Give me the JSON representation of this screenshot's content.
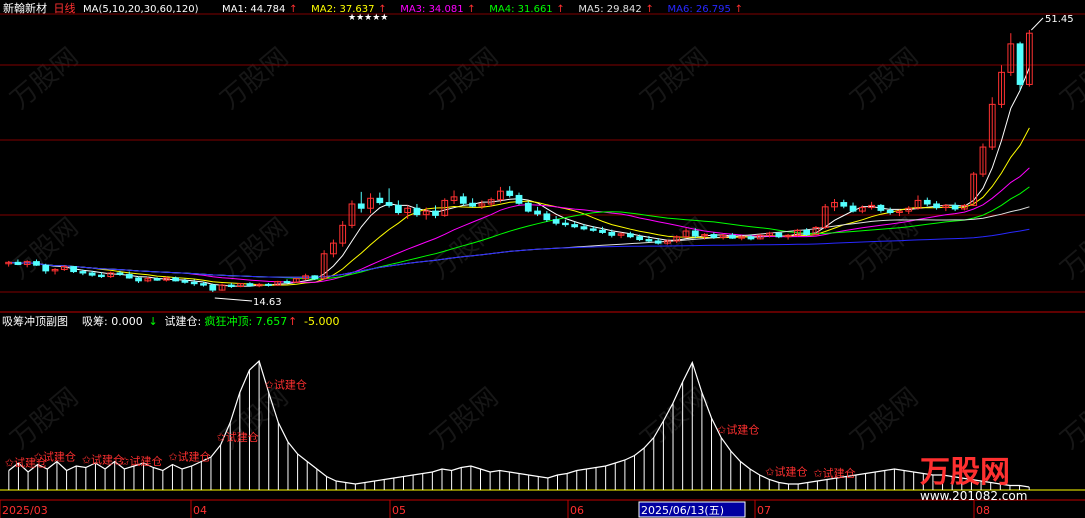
{
  "header": {
    "stock_name": "新翰新材",
    "period": "日线",
    "ma_spec": "MA(5,10,20,30,60,120)",
    "ma_items": [
      {
        "label": "MA1: 44.784",
        "arrow": "↑",
        "color": "#ffffff"
      },
      {
        "label": "MA2: 37.637",
        "arrow": "↑",
        "color": "#ffff00"
      },
      {
        "label": "MA3: 34.081",
        "arrow": "↑",
        "color": "#ff00ff"
      },
      {
        "label": "MA4: 31.661",
        "arrow": "↑",
        "color": "#00ff00"
      },
      {
        "label": "MA5: 29.842",
        "arrow": "↑",
        "color": "#e0e0e0"
      },
      {
        "label": "MA6: 26.795",
        "arrow": "↑",
        "color": "#2828ff"
      }
    ]
  },
  "sub_header": {
    "name": "吸筹冲顶副图",
    "items": [
      {
        "label": "吸筹: 0.000",
        "arrow": "↓",
        "color": "#ffffff",
        "arrow_color": "#00ff00"
      },
      {
        "label": "试建仓:",
        "arrow": "",
        "color": "#ffffff",
        "arrow_color": "#ffffff"
      },
      {
        "label": "疯狂冲顶: 7.657",
        "arrow": "↑",
        "color": "#00ff00",
        "arrow_color": "#ff3030"
      },
      {
        "label": "-5.000",
        "arrow": "",
        "color": "#ffff00",
        "arrow_color": "#ffff00"
      }
    ]
  },
  "annotations": {
    "low_price": "14.63",
    "high_price": "51.45",
    "signal_label": "试建仓",
    "star_marks": "★★★★★"
  },
  "x_axis": {
    "labels": [
      {
        "text": "2025/03",
        "color": "#ff3030"
      },
      {
        "text": "04",
        "color": "#ff3030"
      },
      {
        "text": "05",
        "color": "#ff3030"
      },
      {
        "text": "06",
        "color": "#ff3030"
      },
      {
        "text": "2025/06/13(五)",
        "color": "#ffffff",
        "highlight": true
      },
      {
        "text": "07",
        "color": "#ff3030"
      },
      {
        "text": "08",
        "color": "#ff3030"
      }
    ]
  },
  "watermark": {
    "brand": "万股网",
    "url": "www.201082.com"
  },
  "colors": {
    "up": "#ff3232",
    "down": "#54ffff",
    "grid": "#800000",
    "background": "#000000"
  },
  "chart_data": {
    "type": "candlestick",
    "price_range": [
      14.63,
      51.45
    ],
    "candles": [
      {
        "o": 18.6,
        "h": 19.0,
        "l": 18.2,
        "c": 18.8
      },
      {
        "o": 18.8,
        "h": 19.2,
        "l": 18.4,
        "c": 18.5
      },
      {
        "o": 18.5,
        "h": 19.1,
        "l": 18.1,
        "c": 18.9
      },
      {
        "o": 18.9,
        "h": 19.2,
        "l": 18.3,
        "c": 18.4
      },
      {
        "o": 18.4,
        "h": 18.6,
        "l": 17.2,
        "c": 17.6
      },
      {
        "o": 17.6,
        "h": 18.0,
        "l": 17.1,
        "c": 17.8
      },
      {
        "o": 17.8,
        "h": 18.4,
        "l": 17.6,
        "c": 18.2
      },
      {
        "o": 18.2,
        "h": 18.3,
        "l": 17.3,
        "c": 17.5
      },
      {
        "o": 17.5,
        "h": 17.8,
        "l": 17.0,
        "c": 17.3
      },
      {
        "o": 17.3,
        "h": 17.6,
        "l": 16.8,
        "c": 17.0
      },
      {
        "o": 17.0,
        "h": 17.4,
        "l": 16.6,
        "c": 16.8
      },
      {
        "o": 16.8,
        "h": 17.5,
        "l": 16.6,
        "c": 17.3
      },
      {
        "o": 17.3,
        "h": 17.6,
        "l": 16.9,
        "c": 17.1
      },
      {
        "o": 17.1,
        "h": 17.5,
        "l": 16.5,
        "c": 16.6
      },
      {
        "o": 16.6,
        "h": 16.8,
        "l": 15.9,
        "c": 16.2
      },
      {
        "o": 16.2,
        "h": 16.8,
        "l": 16.0,
        "c": 16.5
      },
      {
        "o": 16.5,
        "h": 16.7,
        "l": 16.2,
        "c": 16.3
      },
      {
        "o": 16.3,
        "h": 16.8,
        "l": 16.1,
        "c": 16.6
      },
      {
        "o": 16.6,
        "h": 16.8,
        "l": 16.1,
        "c": 16.2
      },
      {
        "o": 16.2,
        "h": 16.5,
        "l": 15.8,
        "c": 16.0
      },
      {
        "o": 16.0,
        "h": 16.4,
        "l": 15.5,
        "c": 15.8
      },
      {
        "o": 15.8,
        "h": 16.1,
        "l": 15.4,
        "c": 15.6
      },
      {
        "o": 15.6,
        "h": 15.8,
        "l": 14.63,
        "c": 14.9
      },
      {
        "o": 14.9,
        "h": 15.8,
        "l": 14.8,
        "c": 15.6
      },
      {
        "o": 15.6,
        "h": 15.9,
        "l": 15.2,
        "c": 15.4
      },
      {
        "o": 15.4,
        "h": 15.9,
        "l": 15.3,
        "c": 15.8
      },
      {
        "o": 15.8,
        "h": 16.0,
        "l": 15.4,
        "c": 15.5
      },
      {
        "o": 15.5,
        "h": 15.9,
        "l": 15.3,
        "c": 15.7
      },
      {
        "o": 15.7,
        "h": 15.9,
        "l": 15.4,
        "c": 15.6
      },
      {
        "o": 15.6,
        "h": 16.2,
        "l": 15.5,
        "c": 16.1
      },
      {
        "o": 16.1,
        "h": 16.4,
        "l": 15.8,
        "c": 16.0
      },
      {
        "o": 16.0,
        "h": 16.6,
        "l": 15.9,
        "c": 16.5
      },
      {
        "o": 16.5,
        "h": 17.2,
        "l": 16.3,
        "c": 16.9
      },
      {
        "o": 16.9,
        "h": 17.0,
        "l": 16.3,
        "c": 16.5
      },
      {
        "o": 16.5,
        "h": 20.5,
        "l": 16.4,
        "c": 20.0
      },
      {
        "o": 20.0,
        "h": 22.0,
        "l": 19.5,
        "c": 21.5
      },
      {
        "o": 21.5,
        "h": 24.6,
        "l": 21.0,
        "c": 24.0
      },
      {
        "o": 24.0,
        "h": 27.5,
        "l": 23.6,
        "c": 27.0
      },
      {
        "o": 27.0,
        "h": 28.7,
        "l": 25.8,
        "c": 26.4
      },
      {
        "o": 26.4,
        "h": 28.5,
        "l": 25.7,
        "c": 27.8
      },
      {
        "o": 27.8,
        "h": 28.6,
        "l": 26.9,
        "c": 27.2
      },
      {
        "o": 27.2,
        "h": 29.2,
        "l": 26.5,
        "c": 26.8
      },
      {
        "o": 26.8,
        "h": 27.5,
        "l": 25.5,
        "c": 25.8
      },
      {
        "o": 25.8,
        "h": 26.8,
        "l": 24.9,
        "c": 26.4
      },
      {
        "o": 26.4,
        "h": 27.0,
        "l": 25.2,
        "c": 25.5
      },
      {
        "o": 25.5,
        "h": 26.5,
        "l": 24.8,
        "c": 26.0
      },
      {
        "o": 26.0,
        "h": 26.8,
        "l": 25.0,
        "c": 25.4
      },
      {
        "o": 25.4,
        "h": 27.8,
        "l": 25.2,
        "c": 27.5
      },
      {
        "o": 27.5,
        "h": 28.9,
        "l": 27.0,
        "c": 28.0
      },
      {
        "o": 28.0,
        "h": 28.5,
        "l": 26.8,
        "c": 27.1
      },
      {
        "o": 27.1,
        "h": 27.8,
        "l": 26.5,
        "c": 26.7
      },
      {
        "o": 26.7,
        "h": 27.5,
        "l": 26.3,
        "c": 27.0
      },
      {
        "o": 27.0,
        "h": 27.9,
        "l": 26.6,
        "c": 27.6
      },
      {
        "o": 27.6,
        "h": 29.4,
        "l": 27.2,
        "c": 28.8
      },
      {
        "o": 28.8,
        "h": 29.5,
        "l": 27.9,
        "c": 28.2
      },
      {
        "o": 28.2,
        "h": 28.6,
        "l": 26.9,
        "c": 27.1
      },
      {
        "o": 27.1,
        "h": 27.4,
        "l": 25.8,
        "c": 26.0
      },
      {
        "o": 26.0,
        "h": 26.6,
        "l": 25.3,
        "c": 25.6
      },
      {
        "o": 25.6,
        "h": 26.0,
        "l": 24.5,
        "c": 24.8
      },
      {
        "o": 24.8,
        "h": 25.3,
        "l": 24.0,
        "c": 24.3
      },
      {
        "o": 24.3,
        "h": 24.8,
        "l": 23.8,
        "c": 24.1
      },
      {
        "o": 24.1,
        "h": 24.5,
        "l": 23.6,
        "c": 23.8
      },
      {
        "o": 23.8,
        "h": 24.2,
        "l": 23.3,
        "c": 23.5
      },
      {
        "o": 23.5,
        "h": 23.9,
        "l": 23.1,
        "c": 23.3
      },
      {
        "o": 23.3,
        "h": 23.8,
        "l": 22.8,
        "c": 23.0
      },
      {
        "o": 23.0,
        "h": 23.4,
        "l": 22.3,
        "c": 22.6
      },
      {
        "o": 22.6,
        "h": 23.0,
        "l": 22.2,
        "c": 22.8
      },
      {
        "o": 22.8,
        "h": 23.1,
        "l": 22.2,
        "c": 22.4
      },
      {
        "o": 22.4,
        "h": 22.7,
        "l": 21.8,
        "c": 22.0
      },
      {
        "o": 22.0,
        "h": 22.5,
        "l": 21.6,
        "c": 21.8
      },
      {
        "o": 21.8,
        "h": 22.2,
        "l": 21.3,
        "c": 21.5
      },
      {
        "o": 21.5,
        "h": 22.0,
        "l": 21.3,
        "c": 21.8
      },
      {
        "o": 21.8,
        "h": 22.6,
        "l": 21.5,
        "c": 22.4
      },
      {
        "o": 22.4,
        "h": 23.6,
        "l": 22.2,
        "c": 23.2
      },
      {
        "o": 23.2,
        "h": 23.6,
        "l": 22.2,
        "c": 22.5
      },
      {
        "o": 22.5,
        "h": 22.9,
        "l": 22.0,
        "c": 22.7
      },
      {
        "o": 22.7,
        "h": 23.0,
        "l": 22.1,
        "c": 22.3
      },
      {
        "o": 22.3,
        "h": 22.8,
        "l": 22.0,
        "c": 22.6
      },
      {
        "o": 22.6,
        "h": 22.9,
        "l": 22.1,
        "c": 22.2
      },
      {
        "o": 22.2,
        "h": 22.6,
        "l": 21.9,
        "c": 22.4
      },
      {
        "o": 22.4,
        "h": 22.7,
        "l": 21.9,
        "c": 22.1
      },
      {
        "o": 22.1,
        "h": 22.8,
        "l": 22.0,
        "c": 22.6
      },
      {
        "o": 22.6,
        "h": 23.1,
        "l": 22.3,
        "c": 22.9
      },
      {
        "o": 22.9,
        "h": 23.0,
        "l": 22.2,
        "c": 22.4
      },
      {
        "o": 22.4,
        "h": 22.8,
        "l": 22.0,
        "c": 22.6
      },
      {
        "o": 22.6,
        "h": 23.5,
        "l": 22.4,
        "c": 23.3
      },
      {
        "o": 23.3,
        "h": 23.6,
        "l": 22.5,
        "c": 22.7
      },
      {
        "o": 22.7,
        "h": 23.9,
        "l": 22.6,
        "c": 23.7
      },
      {
        "o": 23.7,
        "h": 27.0,
        "l": 23.5,
        "c": 26.6
      },
      {
        "o": 26.6,
        "h": 27.7,
        "l": 26.0,
        "c": 27.2
      },
      {
        "o": 27.2,
        "h": 27.6,
        "l": 26.4,
        "c": 26.7
      },
      {
        "o": 26.7,
        "h": 27.2,
        "l": 25.8,
        "c": 26.0
      },
      {
        "o": 26.0,
        "h": 26.8,
        "l": 25.7,
        "c": 26.5
      },
      {
        "o": 26.5,
        "h": 27.3,
        "l": 26.2,
        "c": 26.8
      },
      {
        "o": 26.8,
        "h": 27.0,
        "l": 25.8,
        "c": 26.1
      },
      {
        "o": 26.1,
        "h": 26.5,
        "l": 25.5,
        "c": 25.8
      },
      {
        "o": 25.8,
        "h": 26.2,
        "l": 25.3,
        "c": 26.0
      },
      {
        "o": 26.0,
        "h": 26.7,
        "l": 25.6,
        "c": 26.4
      },
      {
        "o": 26.4,
        "h": 28.2,
        "l": 26.2,
        "c": 27.5
      },
      {
        "o": 27.5,
        "h": 27.9,
        "l": 26.7,
        "c": 27.0
      },
      {
        "o": 27.0,
        "h": 27.4,
        "l": 26.2,
        "c": 26.5
      },
      {
        "o": 26.5,
        "h": 27.0,
        "l": 26.0,
        "c": 26.8
      },
      {
        "o": 26.8,
        "h": 27.2,
        "l": 26.0,
        "c": 26.3
      },
      {
        "o": 26.3,
        "h": 27.0,
        "l": 26.1,
        "c": 26.8
      },
      {
        "o": 26.8,
        "h": 31.5,
        "l": 26.7,
        "c": 31.2
      },
      {
        "o": 31.2,
        "h": 35.5,
        "l": 30.8,
        "c": 35.0
      },
      {
        "o": 35.0,
        "h": 42.0,
        "l": 34.6,
        "c": 41.0
      },
      {
        "o": 41.0,
        "h": 46.5,
        "l": 40.5,
        "c": 45.5
      },
      {
        "o": 45.5,
        "h": 51.0,
        "l": 45.0,
        "c": 49.5
      },
      {
        "o": 49.5,
        "h": 49.8,
        "l": 43.0,
        "c": 43.8
      },
      {
        "o": 43.8,
        "h": 51.45,
        "l": 43.5,
        "c": 51.0
      }
    ],
    "moving_averages": [
      {
        "name": "MA1",
        "value": 44.784,
        "color": "#ffffff",
        "window": 5
      },
      {
        "name": "MA2",
        "value": 37.637,
        "color": "#ffff00",
        "window": 10
      },
      {
        "name": "MA3",
        "value": 34.081,
        "color": "#ff00ff",
        "window": 20
      },
      {
        "name": "MA4",
        "value": 31.661,
        "color": "#00ff00",
        "window": 30
      },
      {
        "name": "MA5",
        "value": 29.842,
        "color": "#e0e0e0",
        "window": 60
      },
      {
        "name": "MA6",
        "value": 26.795,
        "color": "#2828ff",
        "window": 120
      }
    ],
    "indicator": {
      "range": [
        0,
        10
      ],
      "bars": [
        1.3,
        1.8,
        1.2,
        1.7,
        1.4,
        1.9,
        1.3,
        1.6,
        1.5,
        1.8,
        1.4,
        1.9,
        1.4,
        1.6,
        1.8,
        1.5,
        1.3,
        1.7,
        1.4,
        1.6,
        1.9,
        2.2,
        3.0,
        4.5,
        6.5,
        8.0,
        8.6,
        6.5,
        4.5,
        3.2,
        2.4,
        1.9,
        1.4,
        0.9,
        0.6,
        0.5,
        0.4,
        0.5,
        0.6,
        0.7,
        0.8,
        0.9,
        1.0,
        1.1,
        1.2,
        1.4,
        1.3,
        1.5,
        1.6,
        1.4,
        1.2,
        1.3,
        1.2,
        1.1,
        1.0,
        0.9,
        0.8,
        1.0,
        1.1,
        1.3,
        1.4,
        1.5,
        1.6,
        1.8,
        2.0,
        2.3,
        2.8,
        3.5,
        4.6,
        5.8,
        7.2,
        8.5,
        6.5,
        4.8,
        3.5,
        2.6,
        1.9,
        1.4,
        1.0,
        0.7,
        0.5,
        0.4,
        0.4,
        0.5,
        0.6,
        0.7,
        0.8,
        0.9,
        1.0,
        1.1,
        1.2,
        1.3,
        1.4,
        1.3,
        1.2,
        1.1,
        1.0,
        1.0,
        0.9,
        0.8,
        0.7,
        0.6,
        0.5,
        0.4,
        0.3,
        0.3,
        0.2
      ],
      "signals": [
        0,
        3,
        8,
        12,
        17,
        22,
        27,
        74,
        79,
        84
      ]
    }
  }
}
